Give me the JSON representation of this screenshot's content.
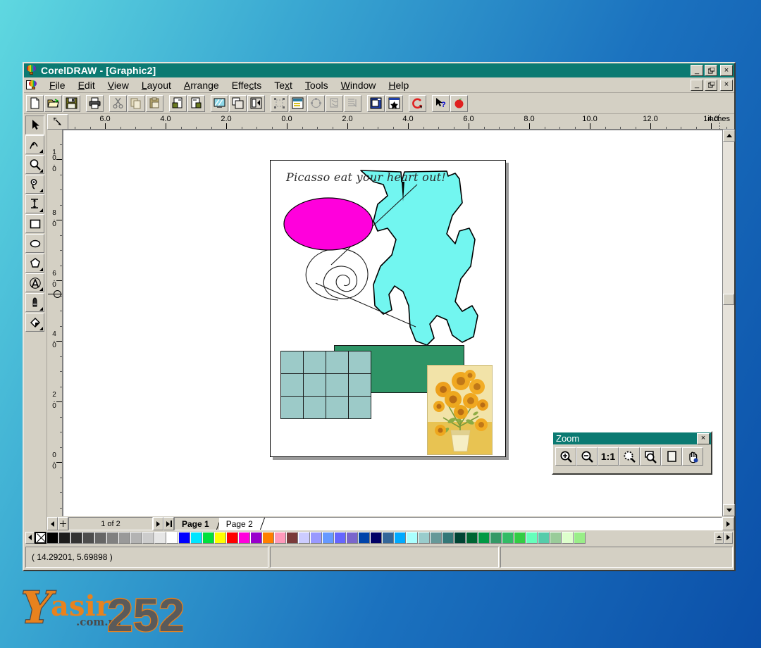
{
  "window": {
    "title": "CorelDRAW - [Graphic2]",
    "app_icon": "corel-balloon-icon",
    "controls": {
      "minimize": "_",
      "restore": "❐",
      "close": "×"
    }
  },
  "menubar": {
    "doc_icon": "document-balloon-icon",
    "items": [
      {
        "label": "File",
        "accel": "F"
      },
      {
        "label": "Edit",
        "accel": "E"
      },
      {
        "label": "View",
        "accel": "V"
      },
      {
        "label": "Layout",
        "accel": "L"
      },
      {
        "label": "Arrange",
        "accel": "A"
      },
      {
        "label": "Effects",
        "accel": "c"
      },
      {
        "label": "Text",
        "accel": "x"
      },
      {
        "label": "Tools",
        "accel": "T"
      },
      {
        "label": "Window",
        "accel": "W"
      },
      {
        "label": "Help",
        "accel": "H"
      }
    ]
  },
  "toolbar": {
    "buttons": [
      {
        "name": "new-document",
        "label": "New"
      },
      {
        "name": "open-document",
        "label": "Open"
      },
      {
        "name": "save-document",
        "label": "Save"
      },
      {
        "name": "print",
        "label": "Print"
      },
      {
        "name": "cut",
        "label": "Cut"
      },
      {
        "name": "copy",
        "label": "Copy"
      },
      {
        "name": "paste",
        "label": "Paste"
      },
      {
        "name": "import",
        "label": "Import"
      },
      {
        "name": "export",
        "label": "Export"
      },
      {
        "name": "full-screen-preview",
        "label": "Full-Screen Preview"
      },
      {
        "name": "show-hide-layers",
        "label": "Layers"
      },
      {
        "name": "symbols-roll-up",
        "label": "Symbols"
      },
      {
        "name": "align-distribute",
        "label": "Align"
      },
      {
        "name": "object-data-roll-up",
        "label": "Object Data"
      },
      {
        "name": "node-edit-roll-up",
        "label": "Node Edit"
      },
      {
        "name": "envelope-roll-up",
        "label": "Envelope"
      },
      {
        "name": "blend-roll-up",
        "label": "Blend"
      },
      {
        "name": "fill-roll-up",
        "label": "Fill Roll-Up"
      },
      {
        "name": "preset-roll-up",
        "label": "Preset Roll-Up"
      },
      {
        "name": "corel-script",
        "label": "CorelSCRIPT"
      },
      {
        "name": "context-help",
        "label": "Context Help"
      },
      {
        "name": "corel-tutor",
        "label": "CorelTUTOR"
      }
    ]
  },
  "toolbox": {
    "tools": [
      {
        "name": "pick-tool",
        "label": "Pick",
        "active": true
      },
      {
        "name": "shape-tool",
        "label": "Shape"
      },
      {
        "name": "zoom-tool",
        "label": "Zoom"
      },
      {
        "name": "pencil-tool",
        "label": "Pencil"
      },
      {
        "name": "dimension-tool",
        "label": "Dimension"
      },
      {
        "name": "rectangle-tool",
        "label": "Rectangle"
      },
      {
        "name": "ellipse-tool",
        "label": "Ellipse"
      },
      {
        "name": "polygon-tool",
        "label": "Polygon"
      },
      {
        "name": "text-tool",
        "label": "Text"
      },
      {
        "name": "outline-pen-tool",
        "label": "Outline Pen"
      },
      {
        "name": "fill-tool",
        "label": "Fill"
      }
    ]
  },
  "rulers": {
    "unit": "inches",
    "horizontal_labels": [
      "6.0",
      "4.0",
      "2.0",
      "0.0",
      "2.0",
      "4.0",
      "6.0",
      "8.0",
      "10.0",
      "12.0",
      "14.0"
    ],
    "vertical_labels": [
      "10.0",
      "8.0",
      "6.0",
      "4.0",
      "2.0",
      "0.0"
    ],
    "origin_marker": "origin-crosshair"
  },
  "artwork": {
    "text": "Picasso eat your heart out!",
    "objects": [
      {
        "name": "magenta-ellipse",
        "fill": "#FF00DC"
      },
      {
        "name": "cyan-blob",
        "fill": "#72F6F0"
      },
      {
        "name": "spiral",
        "fill": "none"
      },
      {
        "name": "diagonal-lines",
        "fill": "none"
      },
      {
        "name": "teal-square-grid",
        "fill": "#9CCAC8",
        "rows": 3,
        "cols": 4
      },
      {
        "name": "green-rectangle",
        "fill": "#2E9466"
      },
      {
        "name": "sunflowers-bitmap",
        "caption": "Sunflowers"
      }
    ]
  },
  "zoom_palette": {
    "title": "Zoom",
    "close": "×",
    "buttons": [
      {
        "name": "zoom-in",
        "label": "Zoom In"
      },
      {
        "name": "zoom-out",
        "label": "Zoom Out"
      },
      {
        "name": "zoom-actual-size",
        "label": "1:1"
      },
      {
        "name": "zoom-to-selection",
        "label": "Zoom To Selected"
      },
      {
        "name": "zoom-to-fit",
        "label": "Zoom To Fit"
      },
      {
        "name": "zoom-to-page",
        "label": "Zoom To Page"
      },
      {
        "name": "pan-tool",
        "label": "Pan"
      }
    ]
  },
  "pagebar": {
    "first": "◀",
    "add_page": "+",
    "next": "▶",
    "last": "▶|",
    "counter": "1 of 2",
    "tabs": [
      {
        "label": "Page 1",
        "active": true
      },
      {
        "label": "Page 2",
        "active": false
      }
    ]
  },
  "statusbar": {
    "coordinates": "( 14.29201, 5.69898 )",
    "panel2": "",
    "panel3": ""
  },
  "palette": {
    "no_color_label": "No Color",
    "scroll_left": "◀",
    "scroll_top": "↑",
    "scroll_right": "▶",
    "colors": [
      "#000000",
      "#1c1c1c",
      "#333333",
      "#4d4d4d",
      "#666666",
      "#808080",
      "#999999",
      "#b3b3b3",
      "#cccccc",
      "#e6e6e6",
      "#ffffff",
      "#0000ff",
      "#00e5ff",
      "#00e03c",
      "#ffff00",
      "#ff0000",
      "#ff00dc",
      "#9900cc",
      "#ff7f00",
      "#ff99bb",
      "#7a3a3a",
      "#ccccff",
      "#9999ff",
      "#6699ff",
      "#6666ff",
      "#7a66cc",
      "#0044aa",
      "#000066",
      "#336699",
      "#00aaff",
      "#aaffff",
      "#99cccc",
      "#669999",
      "#337777",
      "#004433",
      "#006633",
      "#009944",
      "#339966",
      "#33bb66",
      "#33cc44",
      "#66ffbb",
      "#55ccaa",
      "#99cc99",
      "#ddffcc",
      "#99ee88"
    ]
  },
  "watermark": {
    "brand": "asir",
    "initial": "Y",
    "domain": ".com.ru",
    "number": "252"
  }
}
